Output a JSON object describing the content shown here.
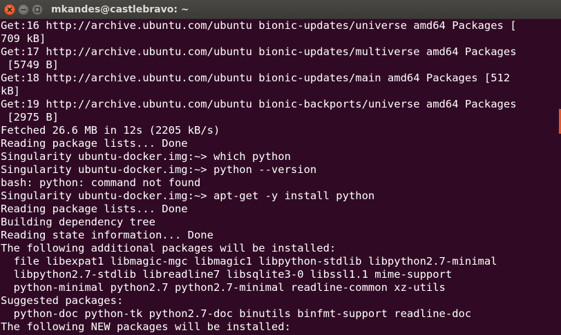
{
  "window": {
    "title": "mkandes@castlebravo: ~",
    "buttons": {
      "close_icon": "close-icon",
      "minimize_icon": "minimize-icon",
      "maximize_icon": "maximize-icon"
    }
  },
  "colors": {
    "terminal_background": "#300a24",
    "terminal_text": "#ffffff",
    "close_button": "#e95420",
    "scrollbar_thumb": "#e95420"
  },
  "terminal": {
    "lines": [
      "Get:16 http://archive.ubuntu.com/ubuntu bionic-updates/universe amd64 Packages [",
      "709 kB]",
      "Get:17 http://archive.ubuntu.com/ubuntu bionic-updates/multiverse amd64 Packages",
      " [5749 B]",
      "Get:18 http://archive.ubuntu.com/ubuntu bionic-updates/main amd64 Packages [512",
      "kB]",
      "Get:19 http://archive.ubuntu.com/ubuntu bionic-backports/universe amd64 Packages",
      " [2975 B]",
      "Fetched 26.6 MB in 12s (2205 kB/s)",
      "Reading package lists... Done",
      "Singularity ubuntu-docker.img:~> which python",
      "Singularity ubuntu-docker.img:~> python --version",
      "bash: python: command not found",
      "Singularity ubuntu-docker.img:~> apt-get -y install python",
      "Reading package lists... Done",
      "Building dependency tree",
      "Reading state information... Done",
      "The following additional packages will be installed:",
      "  file libexpat1 libmagic-mgc libmagic1 libpython-stdlib libpython2.7-minimal",
      "  libpython2.7-stdlib libreadline7 libsqlite3-0 libssl1.1 mime-support",
      "  python-minimal python2.7 python2.7-minimal readline-common xz-utils",
      "Suggested packages:",
      "  python-doc python-tk python2.7-doc binutils binfmt-support readline-doc",
      "The following NEW packages will be installed:"
    ]
  }
}
